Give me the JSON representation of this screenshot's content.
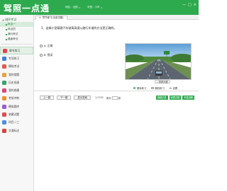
{
  "app": {
    "logo": "驾照一点通"
  },
  "topbar": {
    "fields": [
      {
        "label": "地区：全国"
      },
      {
        "label": "车型：小车"
      }
    ],
    "controls": [
      "—",
      "□",
      "✕"
    ]
  },
  "sidebar": {
    "tree_root": "顺序考试",
    "tree_items": [
      {
        "label": "科目一",
        "selected": true
      },
      {
        "label": "科目四",
        "selected": false
      },
      {
        "label": "满分考试",
        "selected": false
      },
      {
        "label": "路面考试",
        "selected": false
      }
    ],
    "menu": [
      {
        "label": "章节练习",
        "color": "#e8434a",
        "active": true
      },
      {
        "label": "专项练习",
        "color": "#3f7fd6",
        "active": false
      },
      {
        "label": "模拟考试",
        "color": "#e2574c",
        "active": false
      },
      {
        "label": "我的错题",
        "color": "#e8a33a",
        "active": false
      },
      {
        "label": "历史成绩",
        "color": "#3aa36b",
        "active": false
      },
      {
        "label": "我的收藏",
        "color": "#d94a77",
        "active": false
      },
      {
        "label": "考前冲刺",
        "color": "#f08f2f",
        "active": false
      },
      {
        "label": "模拟题库",
        "color": "#9b5cc9",
        "active": false
      },
      {
        "label": "收藏试题",
        "color": "#e34b4b",
        "active": false
      },
      {
        "label": "科目二三",
        "color": "#4a8fe0",
        "active": false
      },
      {
        "label": "交通标志",
        "color": "#d9423c",
        "active": false
      }
    ]
  },
  "tabs": [
    {
      "label": "章节练习(全部试题)"
    }
  ],
  "question": {
    "text": "1、这辆小型载客汽车驶离高速公路行车道的方法是正确的。",
    "options": [
      "A: 正确",
      "B: 错误"
    ],
    "zoom_label": "查看大图"
  },
  "modes": [
    {
      "label": "顺序练习",
      "selected": true
    },
    {
      "label": "随机练习",
      "selected": false
    },
    {
      "label": "设置",
      "selected": false
    }
  ],
  "nav": {
    "prev": "上一题",
    "next": "下一题",
    "show_answer": "显示答案",
    "counter": "1/1765",
    "jump_label": "跳到",
    "jump_btn": "题"
  },
  "actions": [
    "错题记录",
    "收藏试题",
    "本题讲解"
  ]
}
